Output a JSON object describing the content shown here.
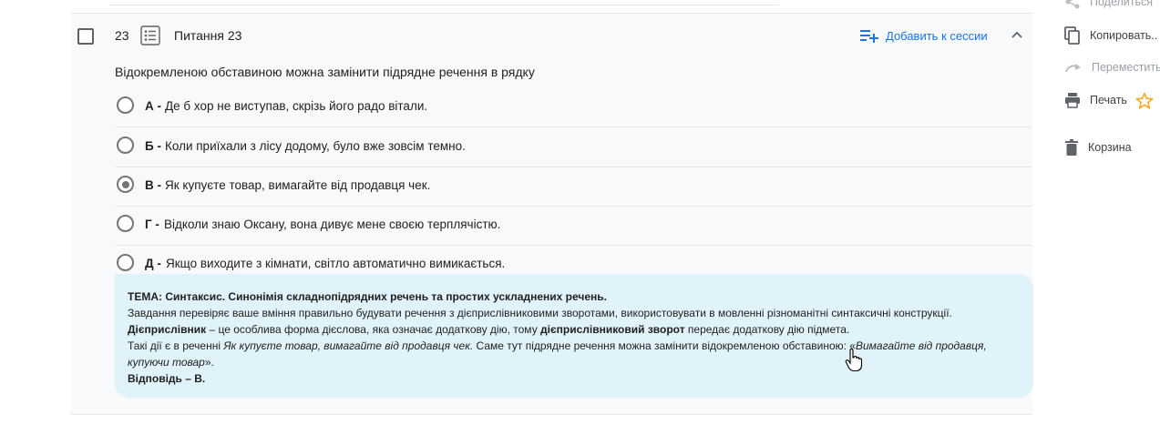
{
  "question": {
    "number": "23",
    "title": "Питання 23",
    "add_to_session": "Добавить к сессии",
    "text": "Відокремленою обставиною можна замінити підрядне речення в рядку"
  },
  "options": [
    {
      "letter": "А -",
      "text": "Де б хор не виступав, скрізь його радо вітали.",
      "selected": false
    },
    {
      "letter": "Б -",
      "text": "Коли приїхали з лісу додому, було вже зовсім темно.",
      "selected": false
    },
    {
      "letter": "В -",
      "text": "Як купуєте товар, вимагайте від продавця чек.",
      "selected": true
    },
    {
      "letter": "Г -",
      "text": "Відколи знаю Оксану, вона дивує мене своєю терплячістю.",
      "selected": false
    },
    {
      "letter": "Д -",
      "text": "Якщо виходите з кімнати, світло автоматично вимикається.",
      "selected": false
    }
  ],
  "explanation": {
    "theme": "ТЕМА: Синтаксис. Синонімія складнопідрядних речень та простих ускладнених речень.",
    "task": "Завдання перевіряє ваше вміння правильно будувати речення з дієприслівниковими зворотами, використовувати в мовленні різноманітні синтаксичні конструкції.",
    "def_term": "Дієприслівник",
    "def_mid": " – це особлива форма дієслова, яка означає додаткову дію, тому ",
    "def_term2": "дієприслівниковий зворот",
    "def_end": " передає додаткову дію підмета.",
    "line4_a": "Такі дії є в реченні ",
    "line4_italic": "Як купуєте товар, вимагайте від продавця чек.",
    "line4_b": " Саме тут підрядне речення можна замінити відокремленою обставиною: «",
    "line4_italic2": "Вимагайте від продавця, купуючи товар",
    "line4_c": "».",
    "answer": "Відповідь – В."
  },
  "sidebar": {
    "share": "Поделиться",
    "copy": "Копировать..",
    "move": "Переместить",
    "print": "Печать",
    "trash": "Корзина"
  },
  "colors": {
    "accent": "#1a73e8",
    "explanation_bg": "#e0f2fa",
    "star": "#f9a825"
  }
}
